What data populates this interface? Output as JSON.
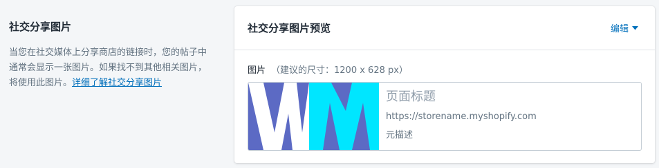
{
  "section": {
    "heading": "社交分享图片",
    "description": "当您在社交媒体上分享商店的链接时，您的帖子中通常会显示一张图片。如果找不到其他相关图片，将使用此图片。",
    "learn_more_link": "详细了解社交分享图片"
  },
  "card": {
    "title": "社交分享图片预览",
    "edit_label": "编辑",
    "image_label": "图片",
    "image_hint": "（建议的尺寸：1200 x 628 px）",
    "preview": {
      "page_title": "页面标题",
      "url": "https://storename.myshopify.com",
      "meta_description": "元描述"
    }
  },
  "colors": {
    "link": "#006fbb",
    "logo_blue": "#5c6ac4",
    "logo_cyan": "#00e6ff"
  },
  "icons": {
    "edit_dropdown": "caret-down-icon",
    "thumbnail": "wm-logo"
  }
}
